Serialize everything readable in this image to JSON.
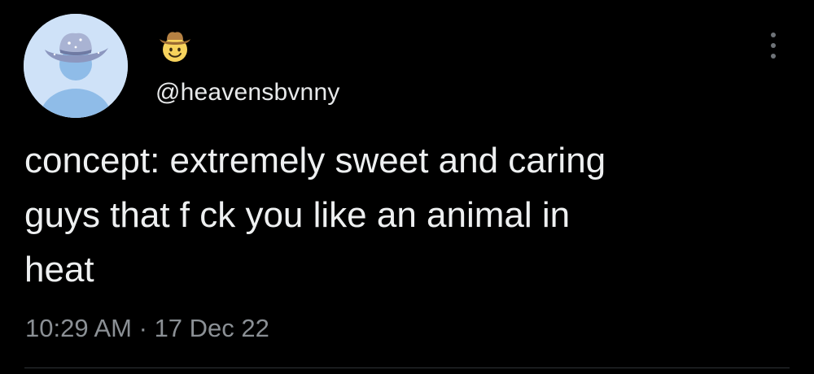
{
  "tweet": {
    "display_name_icon": "cowboy-hat-face-emoji",
    "avatar_icon": "avatar-with-cowboy-hat",
    "handle": "@heavensbvnny",
    "text": "concept: extremely sweet and caring\nguys that f  ck you like an animal in\nheat",
    "time": "10:29 AM",
    "separator": "·",
    "date": "17 Dec 22",
    "more_icon": "vertical-ellipsis-icon"
  },
  "colors": {
    "background": "#000000",
    "text_primary": "#e7e9ea",
    "text_secondary": "#8b9095",
    "avatar_bg": "#cfe2f8",
    "avatar_figure": "#8fbce8",
    "hat": "#9aa6c9"
  }
}
